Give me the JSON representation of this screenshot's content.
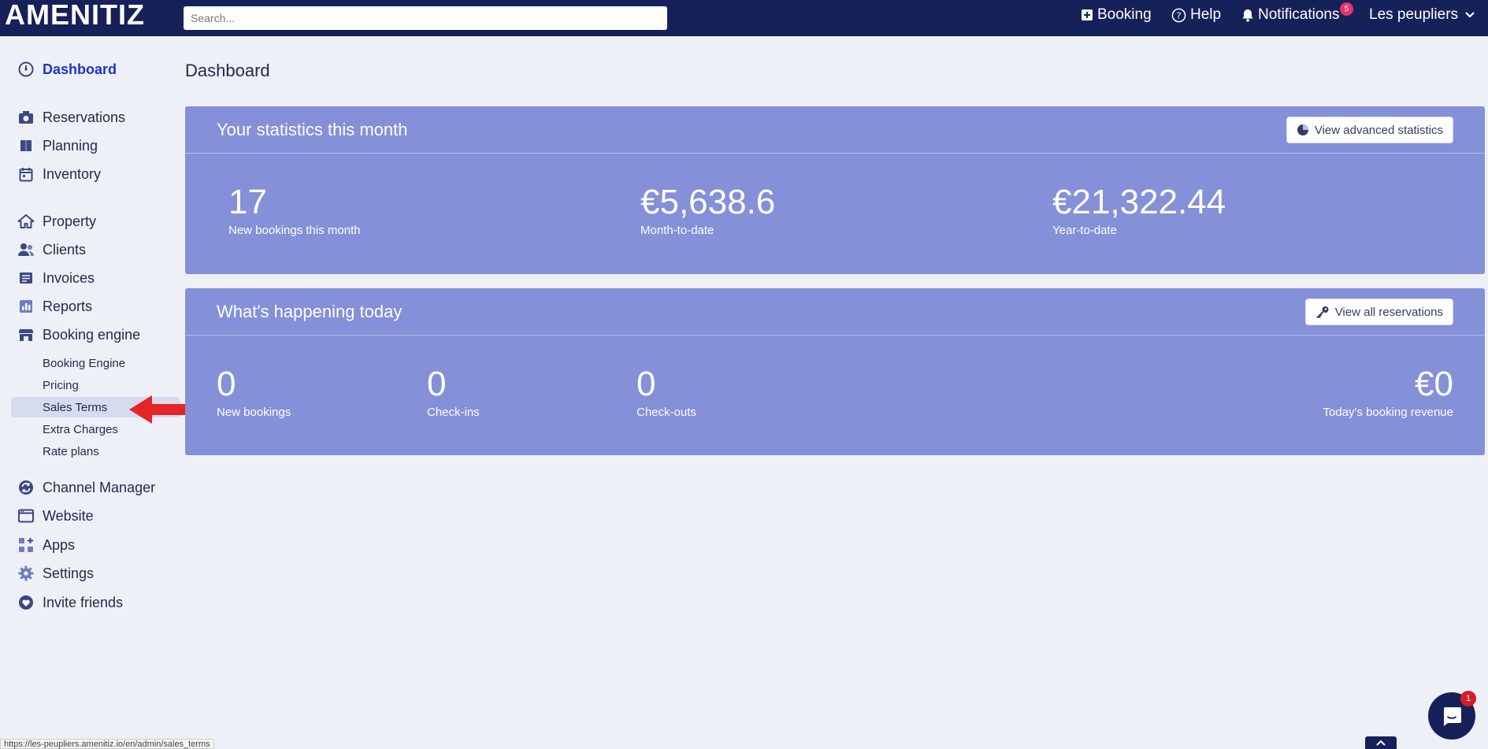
{
  "brand": {
    "name": "AMENITIZ"
  },
  "search": {
    "placeholder": "Search..."
  },
  "topnav": {
    "booking": "Booking",
    "help": "Help",
    "notifications": "Notifications",
    "notifications_count": "5",
    "user": "Les peupliers"
  },
  "sidebar": {
    "dashboard": "Dashboard",
    "reservations": "Reservations",
    "planning": "Planning",
    "inventory": "Inventory",
    "property": "Property",
    "clients": "Clients",
    "invoices": "Invoices",
    "reports": "Reports",
    "booking_engine": "Booking engine",
    "sub": {
      "booking_engine": "Booking Engine",
      "pricing": "Pricing",
      "sales_terms": "Sales Terms",
      "extra_charges": "Extra Charges",
      "rate_plans": "Rate plans"
    },
    "channel_manager": "Channel Manager",
    "website": "Website",
    "apps": "Apps",
    "settings": "Settings",
    "invite_friends": "Invite friends"
  },
  "page": {
    "title": "Dashboard"
  },
  "stats_card": {
    "title": "Your statistics this month",
    "button": "View advanced statistics",
    "items": [
      {
        "value": "17",
        "label": "New bookings this month"
      },
      {
        "value": "€5,638.6",
        "label": "Month-to-date"
      },
      {
        "value": "€21,322.44",
        "label": "Year-to-date"
      }
    ]
  },
  "today_card": {
    "title": "What's happening today",
    "button": "View all reservations",
    "items": [
      {
        "value": "0",
        "label": "New bookings"
      },
      {
        "value": "0",
        "label": "Check-ins"
      },
      {
        "value": "0",
        "label": "Check-outs"
      },
      {
        "value": "€0",
        "label": "Today's booking revenue"
      }
    ]
  },
  "statusbar": {
    "url": "https://les-peupliers.amenitiz.io/en/admin/sales_terms"
  },
  "chat": {
    "badge": "1"
  },
  "colors": {
    "topbar": "#16215a",
    "card": "#8490d8",
    "accent": "#1e34c8",
    "badge": "#e8336f"
  }
}
